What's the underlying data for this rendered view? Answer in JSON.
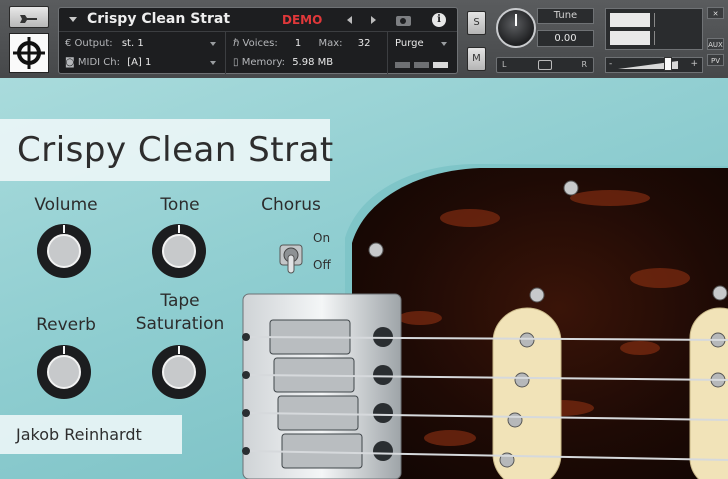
{
  "header": {
    "instrument_name": "Crispy Clean Strat",
    "demo_label": "DEMO",
    "output_label": "Output:",
    "output_value": "st. 1",
    "voices_label": "Voices:",
    "voices_value": "1",
    "max_label": "Max:",
    "max_value": "32",
    "purge_label": "Purge",
    "midi_label": "MIDI Ch:",
    "midi_value": "[A]  1",
    "memory_label": "Memory:",
    "memory_value": "5.98 MB",
    "solo_label": "S",
    "mute_label": "M",
    "tune_label": "Tune",
    "tune_value": "0.00",
    "pan_left": "L",
    "pan_right": "R",
    "vol_minus": "-",
    "vol_plus": "+",
    "side_close": "✕",
    "side_aux": "AUX",
    "side_pv": "PV",
    "info_icon": "i"
  },
  "panel": {
    "title": "Crispy Clean Strat",
    "author": "Jakob Reinhardt",
    "knobs": [
      {
        "label": "Volume"
      },
      {
        "label": "Tone"
      },
      {
        "label": "Reverb"
      },
      {
        "label": "Tape\nSaturation"
      }
    ],
    "chorus": {
      "label": "Chorus",
      "on": "On",
      "off": "Off",
      "state": "off"
    }
  },
  "icons": [
    "wrench-icon",
    "logo-icon",
    "camera-icon",
    "info-icon",
    "left-arrow-icon",
    "right-arrow-icon"
  ]
}
